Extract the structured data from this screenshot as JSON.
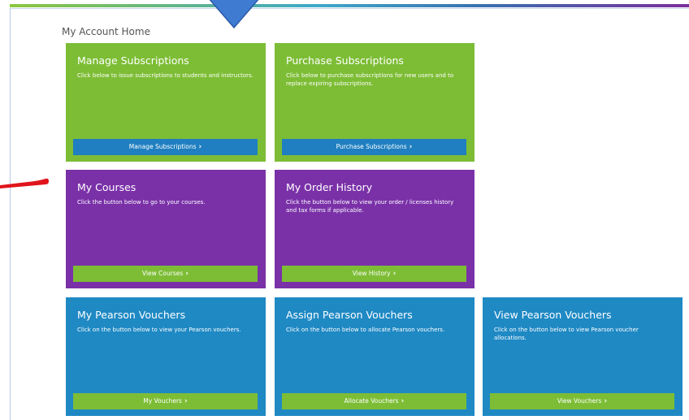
{
  "page": {
    "title": "My Account Home"
  },
  "colors": {
    "green": "#7dbd35",
    "purple": "#7a31a8",
    "blue": "#1f89c4",
    "button_blue": "#1f7fc0",
    "arrow_red": "#e0141c",
    "pointer_blue": "#3f7bd1"
  },
  "cards": {
    "manage_subscriptions": {
      "title": "Manage Subscriptions",
      "description": "Click below to issue subscriptions to students and instructors.",
      "button_label": "Manage Subscriptions",
      "button_icon": "chevron-right-icon"
    },
    "purchase_subscriptions": {
      "title": "Purchase Subscriptions",
      "description": "Click below to purchase subscriptions for new users and to replace expiring subscriptions.",
      "button_label": "Purchase Subscriptions",
      "button_icon": "chevron-right-icon"
    },
    "my_courses": {
      "title": "My Courses",
      "description": "Click the button below to go to your courses.",
      "button_label": "View Courses",
      "button_icon": "chevron-right-icon"
    },
    "my_order_history": {
      "title": "My Order History",
      "description": "Click the button below to view your order / licenses history and tax forms if applicable.",
      "button_label": "View History",
      "button_icon": "chevron-right-icon"
    },
    "my_pearson_vouchers": {
      "title": "My Pearson Vouchers",
      "description": "Click on the button below to view your Pearson vouchers.",
      "button_label": "My Vouchers",
      "button_icon": "chevron-right-icon"
    },
    "assign_pearson_vouchers": {
      "title": "Assign Pearson Vouchers",
      "description": "Click on the button below to allocate Pearson vouchers.",
      "button_label": "Allocate Vouchers",
      "button_icon": "chevron-right-icon"
    },
    "view_pearson_vouchers": {
      "title": "View Pearson Vouchers",
      "description": "Click on the button below to view Pearson voucher allocations.",
      "button_label": "View Vouchers",
      "button_icon": "chevron-right-icon"
    }
  }
}
